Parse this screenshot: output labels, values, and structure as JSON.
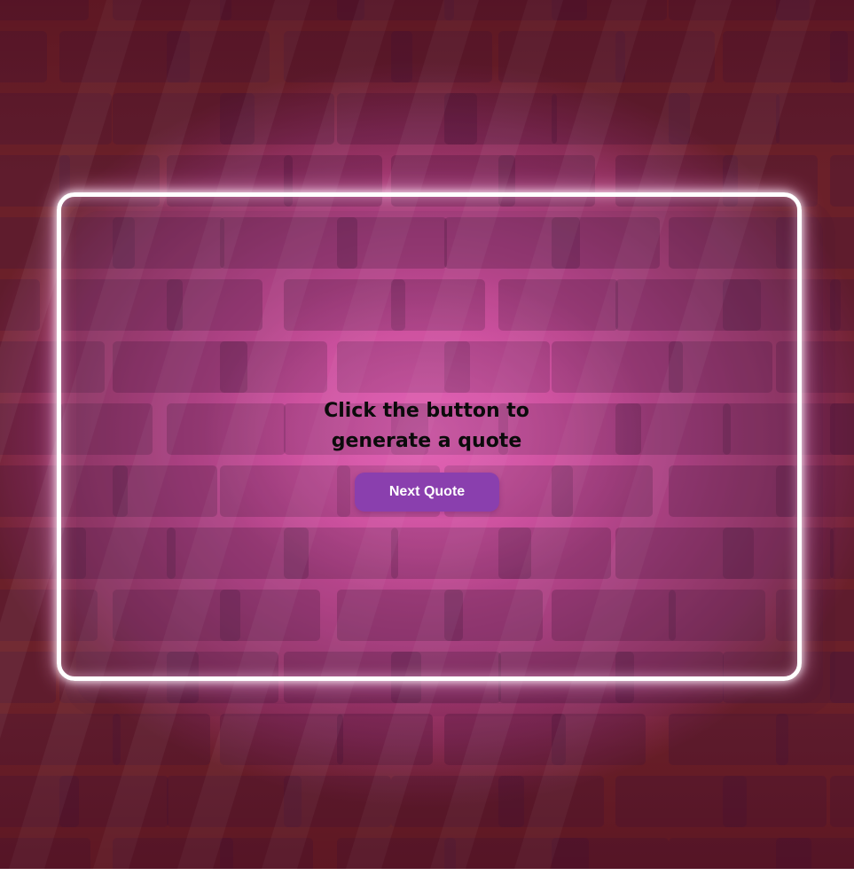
{
  "quote": {
    "text": "Click the button to generate a quote"
  },
  "actions": {
    "next_quote_label": "Next Quote"
  },
  "colors": {
    "wall_center": "#ff63c1",
    "wall_edge": "#6b2029",
    "button": "#8a3fae",
    "button_text": "#ffffff",
    "frame": "#ffffff",
    "text": "#0b0b0b"
  }
}
